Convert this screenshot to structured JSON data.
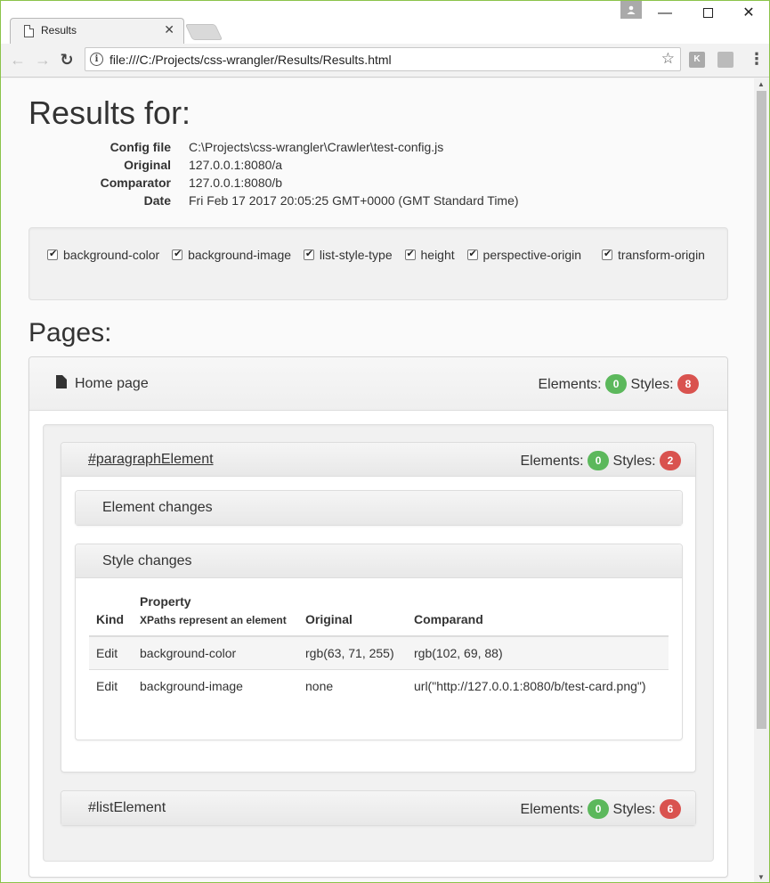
{
  "browser": {
    "tab_title": "Results",
    "tab_close": "✕",
    "url": "file:///C:/Projects/css-wrangler/Results/Results.html",
    "ext1": "K",
    "ext2": "",
    "min": "—",
    "max": "☐",
    "close": "✕",
    "back": "←",
    "forward": "→",
    "reload": "↻",
    "star": "☆",
    "menu": "⋮",
    "info": "i"
  },
  "heading": "Results for:",
  "meta": [
    {
      "key": "Config file",
      "value": "C:\\Projects\\css-wrangler\\Crawler\\test-config.js"
    },
    {
      "key": "Original",
      "value": "127.0.0.1:8080/a"
    },
    {
      "key": "Comparator",
      "value": "127.0.0.1:8080/b"
    },
    {
      "key": "Date",
      "value": "Fri Feb 17 2017 20:05:25 GMT+0000 (GMT Standard Time)"
    }
  ],
  "properties": [
    "background-color",
    "background-image",
    "list-style-type",
    "height",
    "perspective-origin",
    "transform-origin"
  ],
  "pages_heading": "Pages:",
  "labels": {
    "elements": "Elements:",
    "styles": "Styles:"
  },
  "page": {
    "name": "Home page",
    "elements": "0",
    "styles": "8",
    "items": [
      {
        "selector": "#paragraphElement",
        "elements": "0",
        "styles": "2",
        "element_changes": "Element changes",
        "style_changes": "Style changes",
        "table": {
          "headers": {
            "kind": "Kind",
            "property": "Property",
            "property_sub": "XPaths represent an element",
            "original": "Original",
            "comparand": "Comparand"
          },
          "rows": [
            {
              "kind": "Edit",
              "property": "background-color",
              "original": "rgb(63, 71, 255)",
              "comparand": "rgb(102, 69, 88)"
            },
            {
              "kind": "Edit",
              "property": "background-image",
              "original": "none",
              "comparand": "url(\"http://127.0.0.1:8080/b/test-card.png\")"
            }
          ]
        }
      },
      {
        "selector": "#listElement",
        "elements": "0",
        "styles": "6"
      }
    ]
  },
  "colors": {
    "success": "#5cb85c",
    "danger": "#d9534f",
    "window_border": "#8bc34a"
  }
}
